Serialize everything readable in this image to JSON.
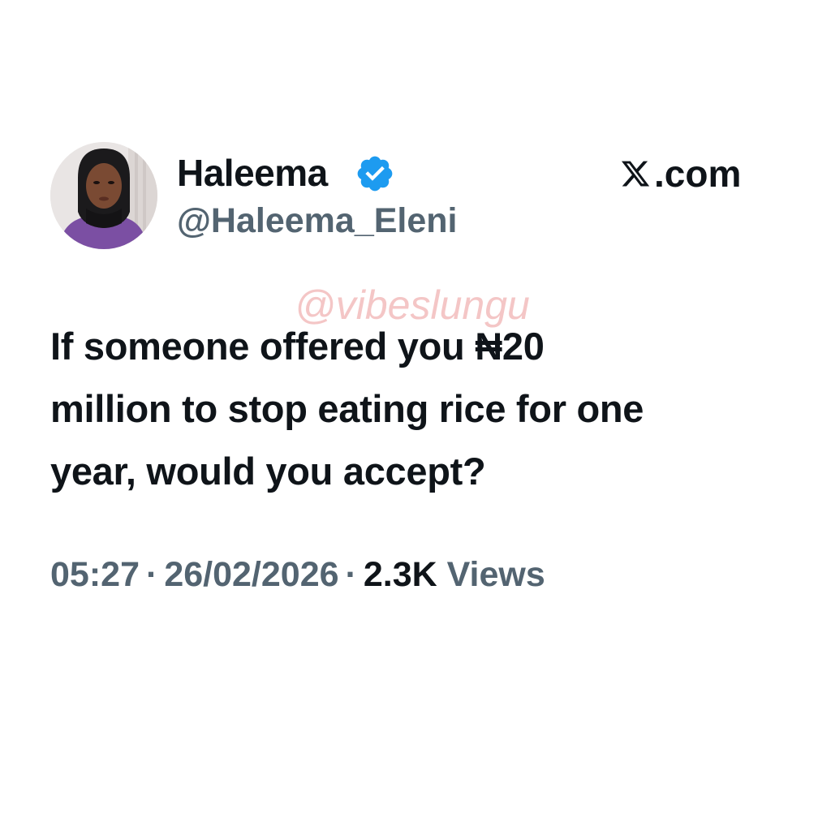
{
  "author": {
    "display_name": "Haleema",
    "handle": "@Haleema_Eleni",
    "verified": true,
    "avatar_icon": "profile-photo"
  },
  "brand": {
    "label": ".com",
    "logo_icon": "x-logo-icon"
  },
  "watermark": "@vibeslungu",
  "tweet": {
    "lines": [
      "If someone offered you ₦20",
      "million to stop eating rice for one",
      "year, would you accept?"
    ]
  },
  "meta": {
    "time": "05:27",
    "separator": "·",
    "date": "26/02/2026",
    "views_count": "2.3K",
    "views_label": "Views"
  },
  "colors": {
    "text_primary": "#0f1419",
    "text_secondary": "#536471",
    "verified_blue": "#1d9bf0",
    "watermark": "#f4c6c6"
  }
}
